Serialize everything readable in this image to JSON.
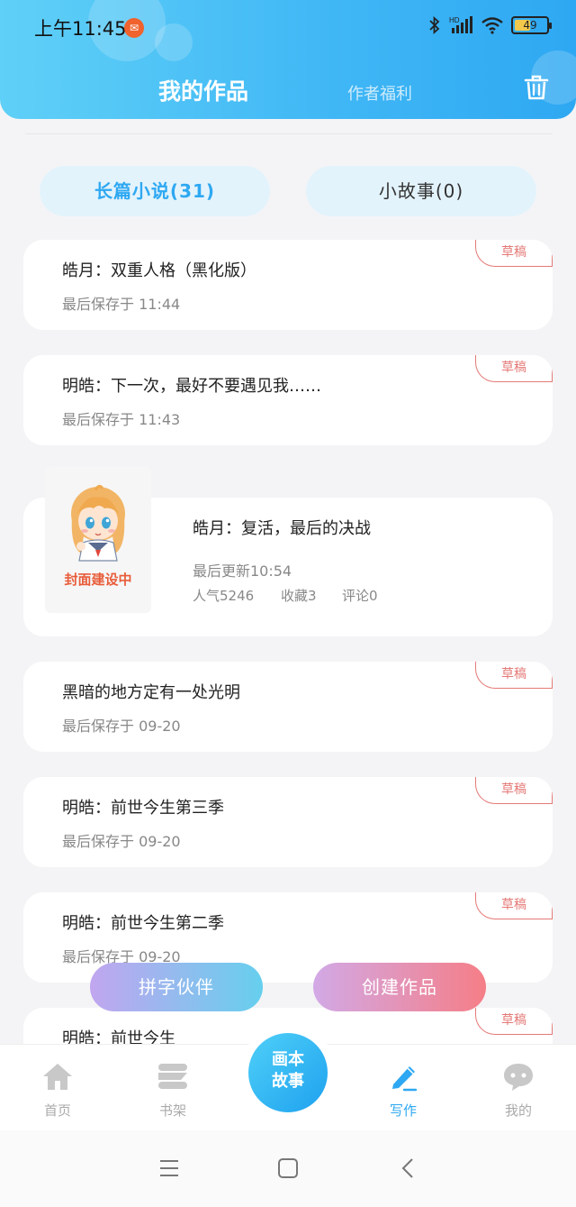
{
  "status_bar": {
    "time": "上午11:45",
    "battery": "49",
    "network": "HD"
  },
  "header": {
    "tab_my_works": "我的作品",
    "tab_author_welfare": "作者福利"
  },
  "type_tabs": [
    {
      "label": "长篇小说(31)"
    },
    {
      "label": "小故事(0)"
    }
  ],
  "works": [
    {
      "title": "皓月：双重人格（黑化版）",
      "meta": "最后保存于 11:44",
      "tag": "草稿"
    },
    {
      "title": "明皓：下一次，最好不要遇见我……",
      "meta": "最后保存于 11:43",
      "tag": "草稿"
    },
    {
      "title": "黑暗的地方定有一处光明",
      "meta": "最后保存于 09-20",
      "tag": "草稿"
    },
    {
      "title": "明皓：前世今生第三季",
      "meta": "最后保存于 09-20",
      "tag": "草稿"
    },
    {
      "title": "明皓：前世今生第二季",
      "meta": "最后保存于 09-20",
      "tag": "草稿"
    },
    {
      "title": "明皓：前世今生",
      "meta": "",
      "tag": "草稿"
    }
  ],
  "published_work": {
    "title": "皓月：复活，最后的决战",
    "updated": "最后更新10:54",
    "popularity": "人气5246",
    "favorites": "收藏3",
    "comments": "评论0",
    "cover_label": "封面建设中"
  },
  "float_buttons": {
    "partner": "拼字伙伴",
    "create": "创建作品"
  },
  "bottom_nav": {
    "home": "首页",
    "bookshelf": "书架",
    "center_line1": "画本",
    "center_line2": "故事",
    "write": "写作",
    "mine": "我的"
  },
  "colors": {
    "accent": "#2ea8f2",
    "draft_tag": "#e47a77"
  }
}
